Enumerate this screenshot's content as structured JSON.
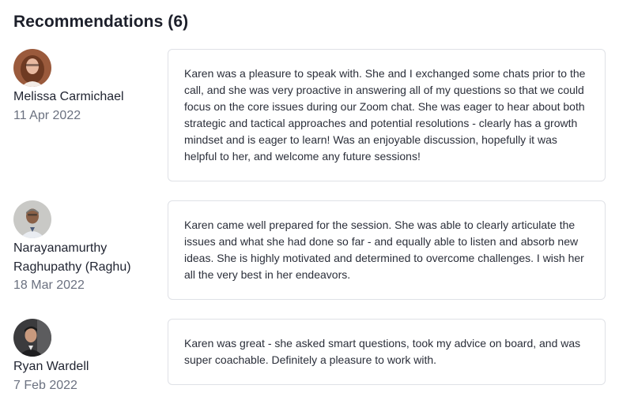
{
  "section": {
    "title": "Recommendations (6)"
  },
  "recommendations": [
    {
      "name": "Melissa Carmichael",
      "date": "11 Apr 2022",
      "text": "Karen was a pleasure to speak with. She and I exchanged some chats prior to the call, and she was very proactive in answering all of my questions so that we could focus on the core issues during our Zoom chat. She was eager to hear about both strategic and tactical approaches and potential resolutions - clearly has a growth mindset and is eager to learn! Was an enjoyable discussion, hopefully it was helpful to her, and welcome any future sessions!"
    },
    {
      "name": "Narayanamurthy Raghupathy (Raghu)",
      "date": "18 Mar 2022",
      "text": "Karen came well prepared for the session. She was able to clearly articulate the issues and what she had done so far - and equally able to listen and absorb new ideas. She is highly motivated and determined to overcome challenges. I wish her all the very best in her endeavors."
    },
    {
      "name": "Ryan Wardell",
      "date": "7 Feb 2022",
      "text": "Karen was great - she asked smart questions, took my advice on board, and was super coachable. Definitely a pleasure to work with."
    }
  ]
}
